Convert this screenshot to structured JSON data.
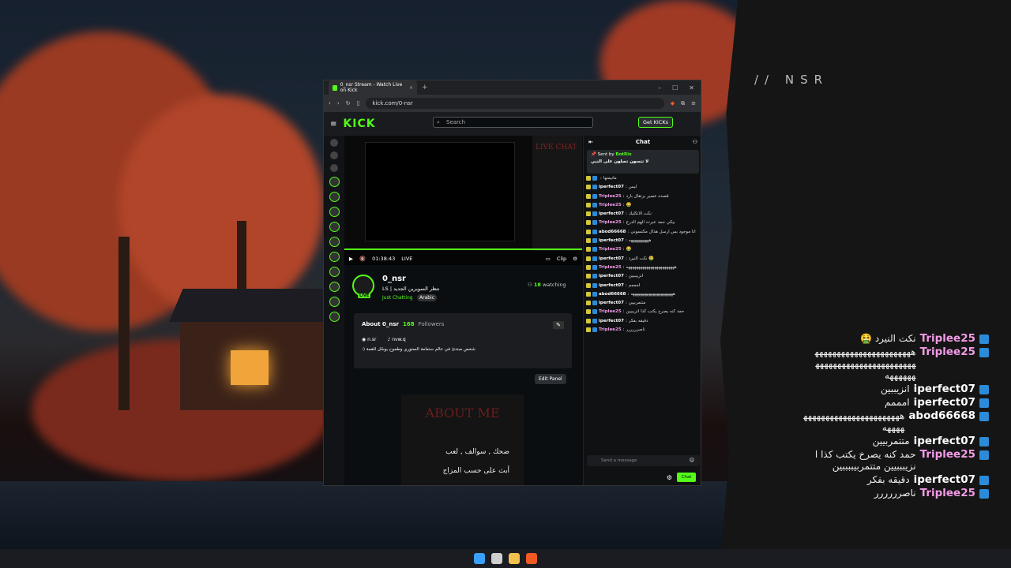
{
  "overlay": {
    "brand": "// NSR",
    "messages": [
      {
        "user": "Triplee25",
        "text": "نكت النيرد 🤮",
        "color": "#f29be6"
      },
      {
        "user": "Triplee25",
        "text": "ههههههههههههههههههههههههههههههههههههههههههههههههههههه",
        "color": "#f29be6"
      },
      {
        "user": "iperfect07",
        "text": "انزيببين",
        "color": "#ffffff"
      },
      {
        "user": "iperfect07",
        "text": "امممم",
        "color": "#ffffff"
      },
      {
        "user": "abod66668",
        "text": "هههههههههههههههههههههههههههه",
        "color": "#ffffff"
      },
      {
        "user": "iperfect07",
        "text": "متتمربيين",
        "color": "#ffffff"
      },
      {
        "user": "Triplee25",
        "text": "حمد كنه يصرخ يكتب كذا انزيبببيين متتمربيببببين",
        "color": "#f29be6"
      },
      {
        "user": "iperfect07",
        "text": "دقيقه بفكر",
        "color": "#ffffff"
      },
      {
        "user": "Triplee25",
        "text": "ناصرررررر",
        "color": "#f29be6"
      }
    ]
  },
  "browser": {
    "tab_title": "0_nsr Stream - Watch Live on Kick",
    "url": "kick.com/0-nsr"
  },
  "kick": {
    "logo": "KICK",
    "search_placeholder": "Search",
    "get_kicks": "Get KICKs",
    "player": {
      "time": "01:38:43",
      "live": "LIVE",
      "clip": "Clip",
      "overlay_text": "LIVE CHAT"
    },
    "channel": {
      "name": "0_nsr",
      "title": "نتظر السوبرين الجديد | LS",
      "category": "Just Chatting",
      "language": "Arabic",
      "watching_count": "18",
      "watching_label": "watching"
    },
    "about": {
      "heading": "About 0_nsr",
      "followers_count": "168",
      "followers_label": "Followers",
      "discord": "n.sr",
      "tiktok": "nvw.q",
      "bio": "شخص مبتدئ في عالم ستعامة الستوري وطموح يوسّل للقمة (:",
      "edit_panel": "Edit Panel",
      "panel_title": "ABOUT ME",
      "panel_line1": "ضحك , سوالف , لعب",
      "panel_line2": "أبث على حسب المزاج"
    }
  },
  "chat": {
    "title": "Chat",
    "pinned_by": "Sent by",
    "pinned_user": "BotRix",
    "pinned_text": "لا تنسون تصلون على النبي",
    "input_placeholder": "Send a message",
    "send_label": "Chat",
    "messages": [
      {
        "user": "",
        "text": "ماتيمتها",
        "color": "#ffffff"
      },
      {
        "user": "iperfect07",
        "text": "ليس",
        "color": "#ffffff"
      },
      {
        "user": "Triplee25",
        "text": "قصده عصير برتقال بارد",
        "color": "#f29be6"
      },
      {
        "user": "Triplee25",
        "text": "🤮",
        "color": "#f29be6"
      },
      {
        "user": "iperfect07",
        "text": "نكت الانكليك",
        "color": "#ffffff"
      },
      {
        "user": "Triplee25",
        "text": "بيكي حمد عبرت الهم الدرج",
        "color": "#f29be6"
      },
      {
        "user": "abod66668",
        "text": "انا موجود بس ارسل هذال مكتسوني",
        "color": "#ffffff"
      },
      {
        "user": "iperfect07",
        "text": "ههههههههههه",
        "color": "#ffffff"
      },
      {
        "user": "Triplee25",
        "text": "🤮",
        "color": "#f29be6"
      },
      {
        "user": "iperfect07",
        "text": "نكت النيرد 🤮",
        "color": "#ffffff"
      },
      {
        "user": "Triplee25",
        "text": "ههههههههههههههههههههههههه",
        "color": "#f29be6"
      },
      {
        "user": "iperfect07",
        "text": "انزيبببين",
        "color": "#ffffff"
      },
      {
        "user": "iperfect07",
        "text": "امممم",
        "color": "#ffffff"
      },
      {
        "user": "abod66668",
        "text": "هههههههههههههههههههههه",
        "color": "#ffffff"
      },
      {
        "user": "iperfect07",
        "text": "متتمربيين",
        "color": "#ffffff"
      },
      {
        "user": "Triplee25",
        "text": "حمد كنه يصرخ يكتب كذا انزيبيين",
        "color": "#f29be6"
      },
      {
        "user": "iperfect07",
        "text": "دقيقه بفكر",
        "color": "#ffffff"
      },
      {
        "user": "Triplee25",
        "text": "ناصرررررر",
        "color": "#f29be6"
      }
    ]
  }
}
